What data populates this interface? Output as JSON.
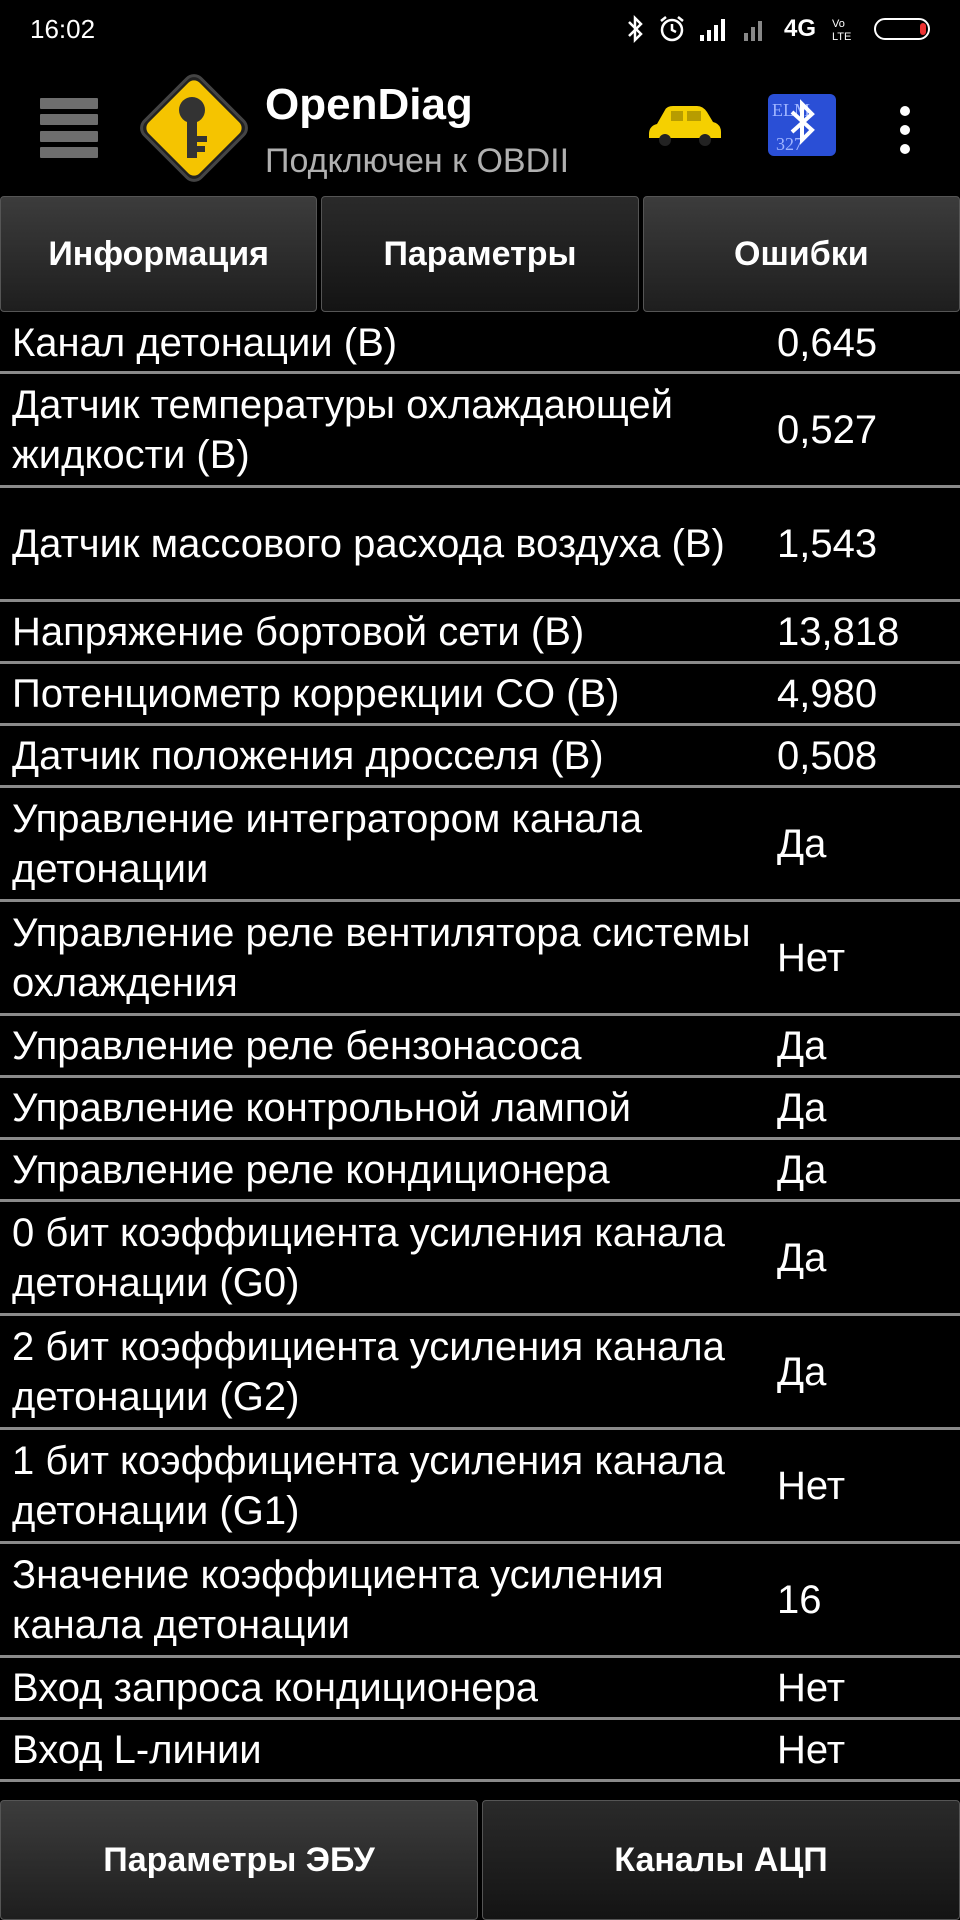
{
  "status_bar": {
    "time": "16:02",
    "network": "4G",
    "volte": "VoLTE"
  },
  "app_bar": {
    "title": "OpenDiag",
    "subtitle": "Подключен к OBDII",
    "icons": [
      "menu-icon",
      "app-logo-key-icon",
      "car-icon",
      "bluetooth-elm327-icon",
      "overflow-menu-icon"
    ]
  },
  "tabs": [
    {
      "label": "Информация",
      "active": false
    },
    {
      "label": "Параметры",
      "active": true
    },
    {
      "label": "Ошибки",
      "active": false
    }
  ],
  "parameters": [
    {
      "name": "Канал детонации (В)",
      "value": "0,645"
    },
    {
      "name": "Датчик температуры охлаждающей жидкости (В)",
      "value": "0,527"
    },
    {
      "name": "Датчик массового расхода воздуха (В)",
      "value": "1,543"
    },
    {
      "name": "Напряжение бортовой сети (В)",
      "value": "13,818"
    },
    {
      "name": "Потенциометр коррекции CO (В)",
      "value": "4,980"
    },
    {
      "name": "Датчик положения дросселя (В)",
      "value": "0,508"
    },
    {
      "name": "Управление интегратором канала детонации",
      "value": "Да"
    },
    {
      "name": "Управление реле вентилятора системы охлаждения",
      "value": "Нет"
    },
    {
      "name": "Управление реле бензонасоса",
      "value": "Да"
    },
    {
      "name": "Управление контрольной лампой",
      "value": "Да"
    },
    {
      "name": "Управление реле кондиционера",
      "value": "Да"
    },
    {
      "name": "0 бит коэффициента усиления канала детонации (G0)",
      "value": "Да"
    },
    {
      "name": "2 бит коэффициента усиления канала детонации (G2)",
      "value": "Да"
    },
    {
      "name": "1 бит коэффициента усиления канала детонации (G1)",
      "value": "Нет"
    },
    {
      "name": "Значение коэффициента усиления канала детонации",
      "value": "16"
    },
    {
      "name": "Вход запроса кондиционера",
      "value": "Нет"
    },
    {
      "name": "Вход L-линии",
      "value": "Нет"
    }
  ],
  "bottom_tabs": [
    {
      "label": "Параметры ЭБУ",
      "active": false
    },
    {
      "label": "Каналы АЦП",
      "active": true
    }
  ],
  "colors": {
    "background": "#000000",
    "divider": "#8a8a8a",
    "logo_yellow": "#f5c400",
    "car_yellow": "#f5d000",
    "bluetooth_blue": "#2a4fd6"
  }
}
